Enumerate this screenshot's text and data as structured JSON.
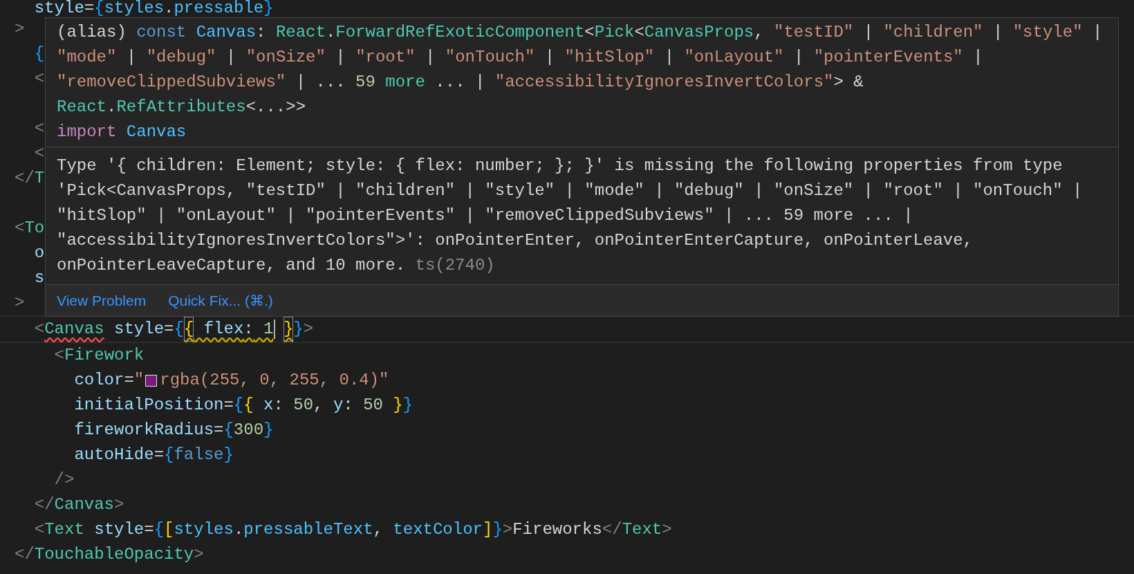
{
  "editor": {
    "lines": [
      {
        "tokens": [
          {
            "text": "  style",
            "kind": "attr"
          },
          {
            "text": "=",
            "kind": "op"
          },
          {
            "text": "{",
            "kind": "b1"
          },
          {
            "text": "styles",
            "kind": "var"
          },
          {
            "text": ".",
            "kind": "op"
          },
          {
            "text": "pressable",
            "kind": "var"
          },
          {
            "text": "}",
            "kind": "b1"
          }
        ]
      },
      {
        "tokens": [
          {
            "text": ">",
            "kind": "p"
          }
        ]
      },
      {
        "tokens": [
          {
            "text": "  {",
            "kind": "b1"
          }
        ]
      },
      {
        "tokens": [
          {
            "text": "  <",
            "kind": "p"
          }
        ]
      },
      {
        "kind": "blank"
      },
      {
        "tokens": [
          {
            "text": "  <",
            "kind": "p"
          }
        ]
      },
      {
        "tokens": [
          {
            "text": "  <",
            "kind": "p"
          }
        ]
      },
      {
        "tokens": [
          {
            "text": "</",
            "kind": "p"
          },
          {
            "text": "T",
            "kind": "tag"
          }
        ]
      },
      {
        "kind": "blank"
      },
      {
        "tokens": [
          {
            "text": "<",
            "kind": "p"
          },
          {
            "text": "To",
            "kind": "tag"
          }
        ]
      },
      {
        "tokens": [
          {
            "text": "  o",
            "kind": "attr"
          }
        ]
      },
      {
        "tokens": [
          {
            "text": "  s",
            "kind": "attr"
          }
        ]
      },
      {
        "tokens": [
          {
            "text": ">",
            "kind": "p"
          }
        ]
      },
      {
        "current": true,
        "tokens": [
          {
            "text": "  <",
            "kind": "p"
          },
          {
            "text": "Canvas",
            "kind": "tag",
            "error": true
          },
          {
            "text": " style",
            "kind": "attr"
          },
          {
            "text": "=",
            "kind": "op"
          },
          {
            "text": "{",
            "kind": "b1"
          },
          {
            "text": "{",
            "kind": "b2",
            "warning": true,
            "match": true
          },
          {
            "text": " flex",
            "kind": "prop",
            "warning": true
          },
          {
            "text": ":",
            "kind": "op",
            "warning": true
          },
          {
            "text": " 1",
            "kind": "num",
            "warning": true
          },
          {
            "kind": "cursor"
          },
          {
            "text": "}",
            "kind": "b2",
            "warning": true,
            "match": true
          },
          {
            "text": "}",
            "kind": "b1"
          },
          {
            "text": ">",
            "kind": "p"
          }
        ]
      },
      {
        "tokens": [
          {
            "text": "    <",
            "kind": "p"
          },
          {
            "text": "Firework",
            "kind": "tag"
          }
        ]
      },
      {
        "tokens": [
          {
            "text": "      color",
            "kind": "attr"
          },
          {
            "text": "=",
            "kind": "op"
          },
          {
            "text": "\"",
            "kind": "str"
          },
          {
            "kind": "swatch",
            "color": "#7a1a7a"
          },
          {
            "text": "rgba(255, 0, 255, 0.4)\"",
            "kind": "str"
          }
        ]
      },
      {
        "tokens": [
          {
            "text": "      initialPosition",
            "kind": "attr"
          },
          {
            "text": "=",
            "kind": "op"
          },
          {
            "text": "{",
            "kind": "b1"
          },
          {
            "text": "{",
            "kind": "b2"
          },
          {
            "text": " x",
            "kind": "prop"
          },
          {
            "text": ":",
            "kind": "op"
          },
          {
            "text": " 50",
            "kind": "num"
          },
          {
            "text": ",",
            "kind": "op"
          },
          {
            "text": " y",
            "kind": "prop"
          },
          {
            "text": ":",
            "kind": "op"
          },
          {
            "text": " 50 ",
            "kind": "num"
          },
          {
            "text": "}",
            "kind": "b2"
          },
          {
            "text": "}",
            "kind": "b1"
          }
        ]
      },
      {
        "tokens": [
          {
            "text": "      fireworkRadius",
            "kind": "attr"
          },
          {
            "text": "=",
            "kind": "op"
          },
          {
            "text": "{",
            "kind": "b1"
          },
          {
            "text": "300",
            "kind": "num"
          },
          {
            "text": "}",
            "kind": "b1"
          }
        ]
      },
      {
        "tokens": [
          {
            "text": "      autoHide",
            "kind": "attr"
          },
          {
            "text": "=",
            "kind": "op"
          },
          {
            "text": "{",
            "kind": "b1"
          },
          {
            "text": "false",
            "kind": "kw"
          },
          {
            "text": "}",
            "kind": "b1"
          }
        ]
      },
      {
        "tokens": [
          {
            "text": "    />",
            "kind": "p"
          }
        ]
      },
      {
        "tokens": [
          {
            "text": "  </",
            "kind": "p"
          },
          {
            "text": "Canvas",
            "kind": "tag"
          },
          {
            "text": ">",
            "kind": "p"
          }
        ]
      },
      {
        "tokens": [
          {
            "text": "  <",
            "kind": "p"
          },
          {
            "text": "Text",
            "kind": "tag"
          },
          {
            "text": " style",
            "kind": "attr"
          },
          {
            "text": "=",
            "kind": "op"
          },
          {
            "text": "{",
            "kind": "b1"
          },
          {
            "text": "[",
            "kind": "b2"
          },
          {
            "text": "styles",
            "kind": "var"
          },
          {
            "text": ".",
            "kind": "op"
          },
          {
            "text": "pressableText",
            "kind": "var"
          },
          {
            "text": ", ",
            "kind": "op"
          },
          {
            "text": "textColor",
            "kind": "var"
          },
          {
            "text": "]",
            "kind": "b2"
          },
          {
            "text": "}",
            "kind": "b1"
          },
          {
            "text": ">",
            "kind": "p"
          },
          {
            "text": "Fireworks",
            "kind": "txt"
          },
          {
            "text": "</",
            "kind": "p"
          },
          {
            "text": "Text",
            "kind": "tag"
          },
          {
            "text": ">",
            "kind": "p"
          }
        ]
      },
      {
        "tokens": [
          {
            "text": "</",
            "kind": "p"
          },
          {
            "text": "TouchableOpacity",
            "kind": "tag"
          },
          {
            "text": ">",
            "kind": "p"
          }
        ]
      }
    ]
  },
  "hover": {
    "signature": [
      {
        "tokens": [
          {
            "text": "(alias) ",
            "kind": "txt"
          },
          {
            "text": "const",
            "kind": "kw"
          },
          {
            "text": " Canvas",
            "kind": "var"
          },
          {
            "text": ": ",
            "kind": "txt"
          },
          {
            "text": "React",
            "kind": "type"
          },
          {
            "text": ".",
            "kind": "txt"
          },
          {
            "text": "ForwardRefExoticComponent",
            "kind": "type"
          },
          {
            "text": "<",
            "kind": "txt"
          },
          {
            "text": "Pick",
            "kind": "type"
          },
          {
            "text": "<",
            "kind": "txt"
          },
          {
            "text": "CanvasProps",
            "kind": "type"
          },
          {
            "text": ", ",
            "kind": "txt"
          },
          {
            "text": "\"testID\"",
            "kind": "str"
          },
          {
            "text": " | ",
            "kind": "txt"
          },
          {
            "text": "\"children\"",
            "kind": "str"
          },
          {
            "text": " | ",
            "kind": "txt"
          },
          {
            "text": "\"style\"",
            "kind": "str"
          },
          {
            "text": " |",
            "kind": "txt"
          }
        ]
      },
      {
        "tokens": [
          {
            "text": "\"mode\"",
            "kind": "str"
          },
          {
            "text": " | ",
            "kind": "txt"
          },
          {
            "text": "\"debug\"",
            "kind": "str"
          },
          {
            "text": " | ",
            "kind": "txt"
          },
          {
            "text": "\"onSize\"",
            "kind": "str"
          },
          {
            "text": " | ",
            "kind": "txt"
          },
          {
            "text": "\"root\"",
            "kind": "str"
          },
          {
            "text": " | ",
            "kind": "txt"
          },
          {
            "text": "\"onTouch\"",
            "kind": "str"
          },
          {
            "text": " | ",
            "kind": "txt"
          },
          {
            "text": "\"hitSlop\"",
            "kind": "str"
          },
          {
            "text": " | ",
            "kind": "txt"
          },
          {
            "text": "\"onLayout\"",
            "kind": "str"
          },
          {
            "text": " | ",
            "kind": "txt"
          },
          {
            "text": "\"pointerEvents\"",
            "kind": "str"
          },
          {
            "text": " |",
            "kind": "txt"
          }
        ]
      },
      {
        "tokens": [
          {
            "text": "\"removeClippedSubviews\"",
            "kind": "str"
          },
          {
            "text": " | ... ",
            "kind": "txt"
          },
          {
            "text": "59",
            "kind": "num"
          },
          {
            "text": " more",
            "kind": "type"
          },
          {
            "text": " ... | ",
            "kind": "txt"
          },
          {
            "text": "\"accessibilityIgnoresInvertColors\"",
            "kind": "str"
          },
          {
            "text": "> &",
            "kind": "txt"
          }
        ]
      },
      {
        "tokens": [
          {
            "text": "React",
            "kind": "type"
          },
          {
            "text": ".",
            "kind": "txt"
          },
          {
            "text": "RefAttributes",
            "kind": "type"
          },
          {
            "text": "<...>>",
            "kind": "txt"
          }
        ]
      },
      {
        "tokens": [
          {
            "text": "import",
            "kind": "ctl"
          },
          {
            "text": " Canvas",
            "kind": "var"
          }
        ]
      }
    ],
    "message": {
      "lines": [
        "Type '{ children: Element; style: { flex: number; }; }' is missing the following properties from type",
        "'Pick<CanvasProps, \"testID\" | \"children\" | \"style\" | \"mode\" | \"debug\" | \"onSize\" | \"root\" | \"onTouch\" |",
        "\"hitSlop\" | \"onLayout\" | \"pointerEvents\" | \"removeClippedSubviews\" | ... 59 more ... |",
        "\"accessibilityIgnoresInvertColors\">': onPointerEnter, onPointerEnterCapture, onPointerLeave,",
        "onPointerLeaveCapture, and 10 more."
      ],
      "code": "ts(2740)"
    },
    "actions": [
      {
        "label": "View Problem"
      },
      {
        "label": "Quick Fix... (⌘.)"
      }
    ]
  }
}
